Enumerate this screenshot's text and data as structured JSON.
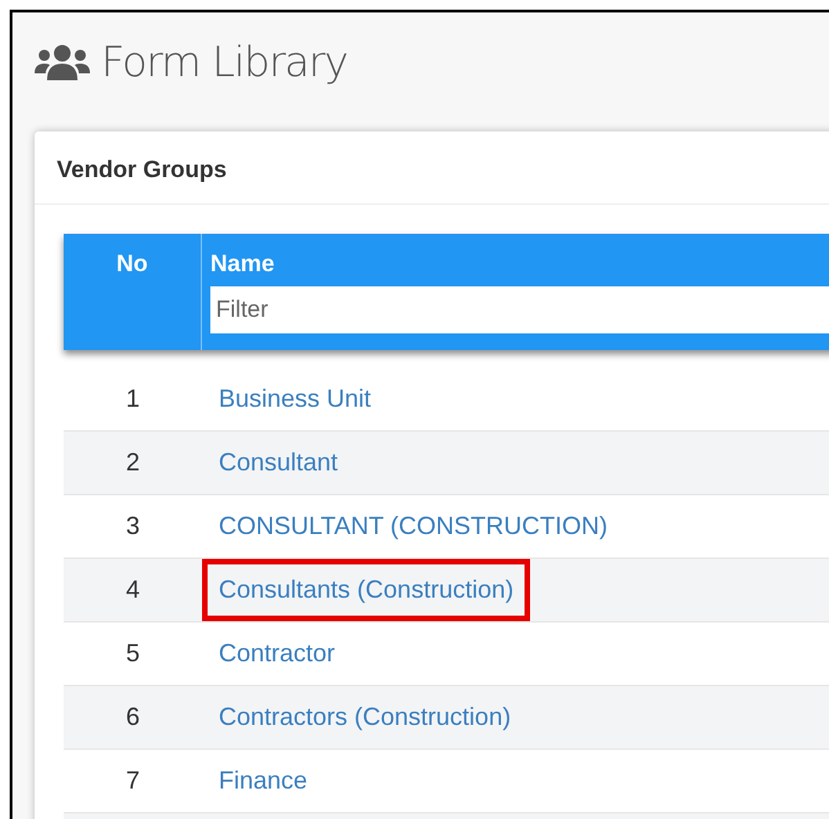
{
  "page": {
    "title": "Form Library"
  },
  "card": {
    "title": "Vendor Groups"
  },
  "table": {
    "columns": [
      "No",
      "Name"
    ],
    "filter": {
      "placeholder": "Filter"
    },
    "rows": [
      {
        "no": "1",
        "name": "Business Unit",
        "highlighted": false
      },
      {
        "no": "2",
        "name": "Consultant",
        "highlighted": false
      },
      {
        "no": "3",
        "name": "CONSULTANT (CONSTRUCTION)",
        "highlighted": false
      },
      {
        "no": "4",
        "name": "Consultants (Construction)",
        "highlighted": true
      },
      {
        "no": "5",
        "name": "Contractor",
        "highlighted": false
      },
      {
        "no": "6",
        "name": "Contractors (Construction)",
        "highlighted": false
      },
      {
        "no": "7",
        "name": "Finance",
        "highlighted": false
      }
    ]
  }
}
